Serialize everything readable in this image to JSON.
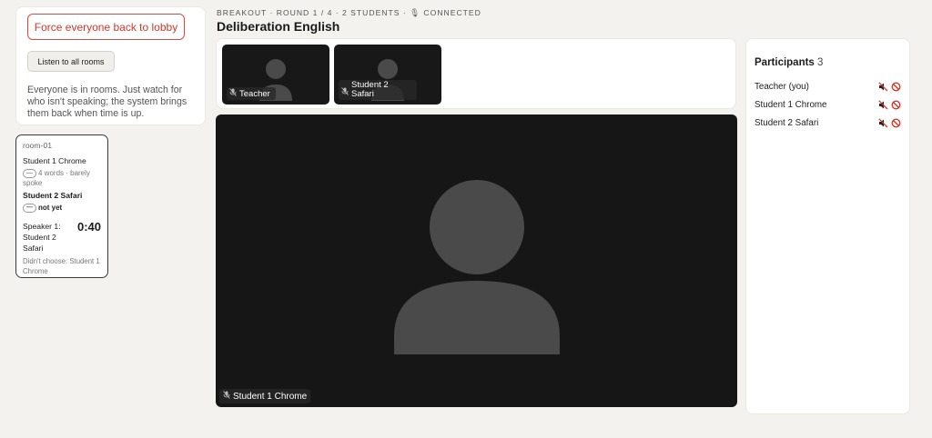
{
  "controls": {
    "force_lobby_label": "Force everyone back to lobby",
    "listen_all_label": "Listen to all rooms",
    "help_text": "Everyone is in rooms. Just watch for who isn't speaking; the system brings them back when time is up."
  },
  "room": {
    "title": "room-01",
    "students": [
      {
        "name": "Student 1 Chrome",
        "pill": "—",
        "status": "4 words · barely spoke"
      },
      {
        "name": "Student 2 Safari",
        "pill": "—",
        "status": "not yet"
      }
    ],
    "speaker_label": "Speaker 1: Student 2 Safari",
    "timer": "0:40",
    "choose_note": "Didn't choose: Student 1 Chrome"
  },
  "header": {
    "meta": "BREAKOUT · ROUND 1 / 4 · 2 STUDENTS · 🎙 CONNECTED",
    "title": "Deliberation English"
  },
  "thumbnails": [
    {
      "label": "Teacher"
    },
    {
      "label": "Student 2 Safari"
    }
  ],
  "main_video": {
    "label": "Student 1 Chrome"
  },
  "participants": {
    "heading": "Participants",
    "count": "3",
    "list": [
      {
        "name": "Teacher (you)"
      },
      {
        "name": "Student 1 Chrome"
      },
      {
        "name": "Student 2 Safari"
      }
    ]
  },
  "icons": {
    "mic_muted": "mic-off-icon",
    "speaker_muted": "speaker-muted-icon",
    "block": "block-icon",
    "avatar": "avatar-silhouette-icon"
  },
  "colors": {
    "accent_red": "#d2382b",
    "video_bg": "#161616",
    "avatar_gray": "#4a4a4a",
    "page_bg": "#f3f2ee"
  }
}
